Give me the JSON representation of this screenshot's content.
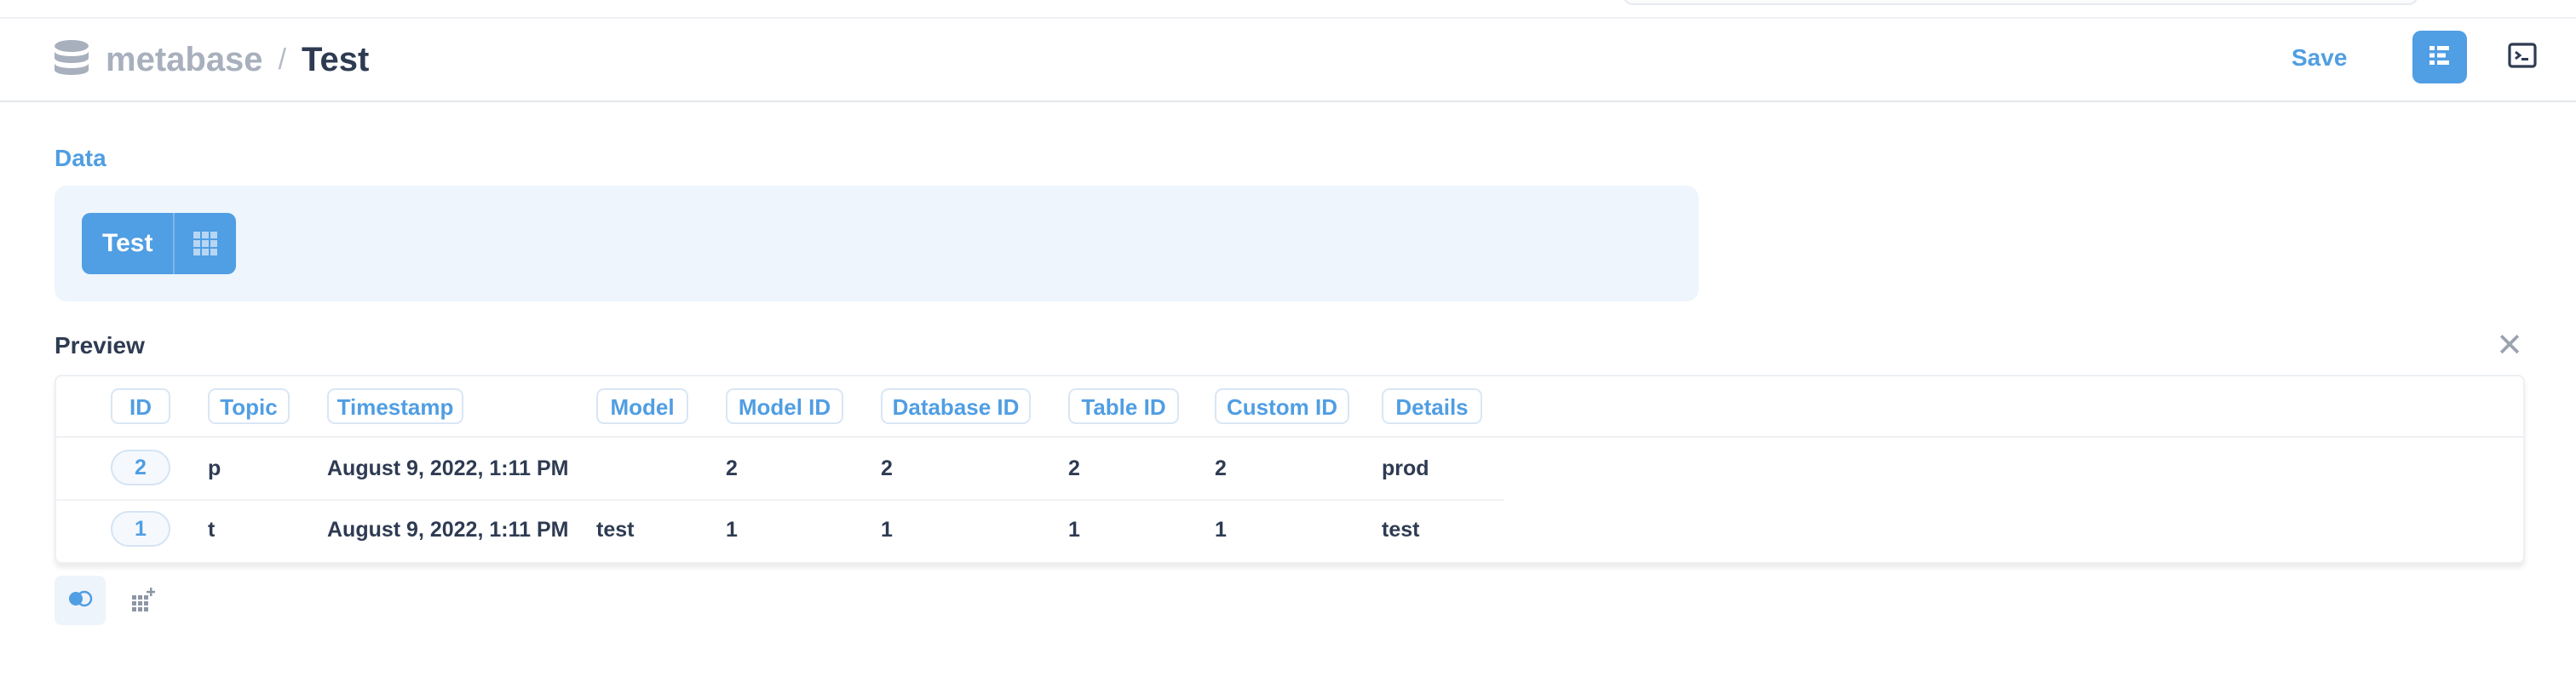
{
  "breadcrumb": {
    "database": "metabase",
    "separator": "/",
    "title": "Test"
  },
  "header": {
    "save_label": "Save"
  },
  "icons": {
    "database": "database-icon",
    "editor": "notebook-editor-icon",
    "console": "console-icon",
    "table": "grid-icon",
    "close": "close-icon",
    "toggle": "toggle-icon",
    "add_column": "add-column-icon"
  },
  "data_section": {
    "label": "Data",
    "source": "Test"
  },
  "preview": {
    "label": "Preview",
    "close_glyph": "✕",
    "columns": [
      "ID",
      "Topic",
      "Timestamp",
      "Model",
      "Model ID",
      "Database ID",
      "Table ID",
      "Custom ID",
      "Details"
    ],
    "rows": [
      [
        "2",
        "p",
        "August 9, 2022, 1:11 PM",
        "",
        "2",
        "2",
        "2",
        "2",
        "prod"
      ],
      [
        "1",
        "t",
        "August 9, 2022, 1:11 PM",
        "test",
        "1",
        "1",
        "1",
        "1",
        "test"
      ]
    ]
  },
  "colors": {
    "brand": "#509ee3",
    "text_dark": "#2e3b52",
    "text_light": "#a8b0bd",
    "data_bg": "#eef5fd"
  }
}
